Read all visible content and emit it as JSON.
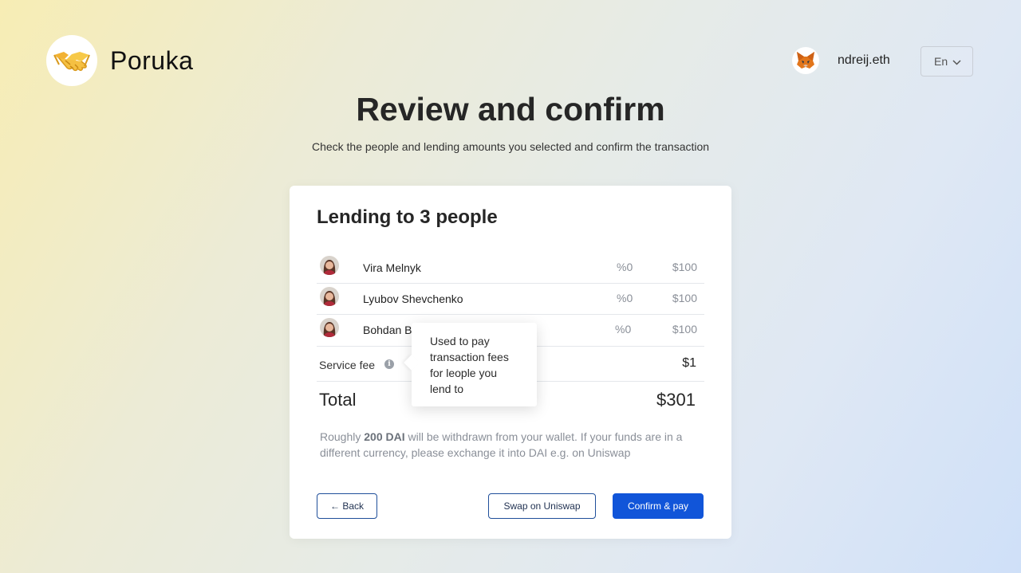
{
  "app": {
    "brand": "Poruka",
    "logo_icon": "handshake-icon"
  },
  "account": {
    "name": "ndreij.eth",
    "wallet_icon": "metamask-fox-icon"
  },
  "language": {
    "selected": "En"
  },
  "page": {
    "title": "Review and confirm",
    "subtitle": "Check the people and lending amounts you selected and confirm the transaction"
  },
  "card": {
    "title": "Lending to 3 people",
    "people": [
      {
        "name": "Vira Melnyk",
        "rate": "%0",
        "amount": "$100"
      },
      {
        "name": "Lyubov Shevchenko",
        "rate": "%0",
        "amount": "$100"
      },
      {
        "name": "Bohdan B",
        "rate": "%0",
        "amount": "$100"
      }
    ],
    "service_fee": {
      "label": "Service fee",
      "amount": "$1"
    },
    "total": {
      "label": "Total",
      "amount": "$301"
    },
    "note": {
      "prefix": "Roughly ",
      "highlight": "200 DAI",
      "suffix": " will be withdrawn from your wallet. If your funds are in a different currency, please exchange it into DAI e.g. on Uniswap"
    },
    "buttons": {
      "back": "← Back",
      "swap": "Swap on Uniswap",
      "confirm": "Confirm & pay"
    }
  },
  "tooltip": {
    "lines": [
      "Used to pay",
      "transaction fees",
      "for leople you",
      "lend to"
    ]
  },
  "colors": {
    "primary": "#1155d9",
    "card_bg": "#ffffff",
    "muted_text": "#8a8f98"
  }
}
